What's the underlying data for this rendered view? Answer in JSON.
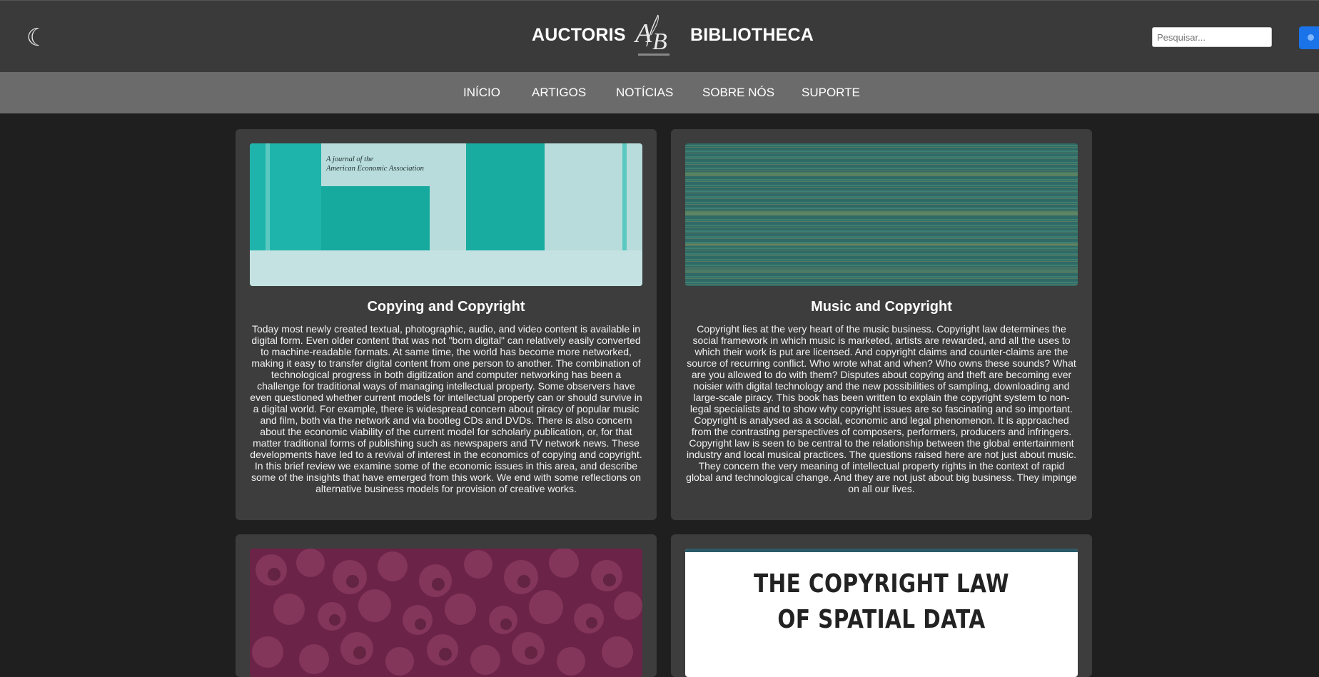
{
  "header": {
    "theme_icon": "moon-icon",
    "brand_left": "AUCTORIS",
    "brand_right": "BIBLIOTHECA",
    "logo_icon": "ab-quill-logo",
    "search_placeholder": "Pesquisar...",
    "search_icon": "search-icon"
  },
  "nav": {
    "items": [
      {
        "label": "INÍCIO"
      },
      {
        "label": "ARTIGOS"
      },
      {
        "label": "NOTÍCIAS"
      },
      {
        "label": "SOBRE NÓS"
      },
      {
        "label": "SUPORTE"
      }
    ]
  },
  "cards": [
    {
      "title": "Copying and Copyright",
      "cover_text_1": "A journal of the",
      "cover_text_2": "American Economic Association",
      "text": "Today most newly created textual, photographic, audio, and video content is available in digital form. Even older content that was not \"born digital\" can relatively easily converted to machine-readable formats. At same time, the world has become more networked, making it easy to transfer digital content from one person to another. The combination of technological progress in both digitization and computer networking has been a challenge for traditional ways of managing intellectual property. Some observers have even questioned whether current models for intellectual property can or should survive in a digital world. For example, there is widespread concern about piracy of popular music and film, both via the network and via bootleg CDs and DVDs. There is also concern about the economic viability of the current model for scholarly publication, or, for that matter traditional forms of publishing such as newspapers and TV network news. These developments have led to a revival of interest in the economics of copying and copyright. In this brief review we examine some of the economic issues in this area, and describe some of the insights that have emerged from this work. We end with some reflections on alternative business models for provision of creative works."
    },
    {
      "title": "Music and Copyright",
      "text": "Copyright lies at the very heart of the music business. Copyright law determines the social framework in which music is marketed, artists are rewarded, and all the uses to which their work is put are licensed. And copyright claims and counter-claims are the source of recurring conflict. Who wrote what and when? Who owns these sounds? What are you allowed to do with them? Disputes about copying and theft are becoming ever noisier with digital technology and the new possibilities of sampling, downloading and large-scale piracy. This book has been written to explain the copyright system to non-legal specialists and to show why copyright issues are so fascinating and so important. Copyright is analysed as a social, economic and legal phenomenon. It is approached from the contrasting perspectives of composers, performers, producers and infringers. Copyright law is seen to be central to the relationship between the global entertainment industry and local musical practices. The questions raised here are not just about music. They concern the very meaning of intellectual property rights in the context of rapid global and technological change. And they are not just about big business. They impinge on all our lives."
    },
    {
      "title": "",
      "text": ""
    },
    {
      "title": "",
      "cover_line_1": "THE COPYRIGHT LAW",
      "cover_line_2": "OF SPATIAL DATA",
      "text": ""
    }
  ]
}
